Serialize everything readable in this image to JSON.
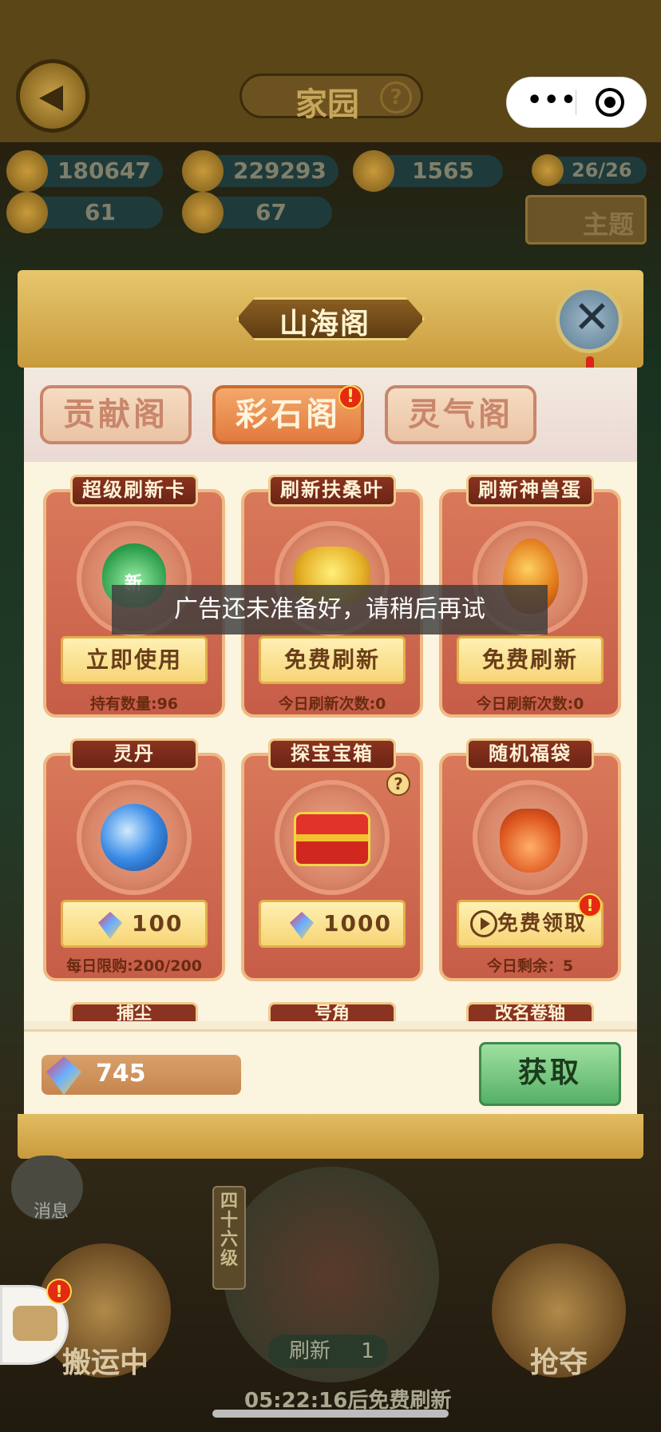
{
  "header": {
    "title": "家园",
    "help_glyph": "?",
    "mini_menu_glyph": "•••"
  },
  "resources": [
    {
      "icon": "gold-ingot-icon",
      "value": "180647"
    },
    {
      "icon": "gold-flower-icon",
      "value": "229293"
    },
    {
      "icon": "gold-lump-icon",
      "value": "1565"
    },
    {
      "icon": "rabbit-icon",
      "value": "26/26"
    },
    {
      "icon": "beast-head-icon",
      "value": "61"
    },
    {
      "icon": "gold-beast-icon",
      "value": "67"
    }
  ],
  "theme_button": "主题",
  "modal": {
    "title": "山海阁",
    "tabs": [
      {
        "label": "贡献阁",
        "active": false
      },
      {
        "label": "彩石阁",
        "active": true,
        "badge": "!"
      },
      {
        "label": "灵气阁",
        "active": false
      }
    ],
    "items": [
      {
        "name": "超级刷新卡",
        "icon": "new-refresh-card-icon",
        "icon_text": "新",
        "button": "立即使用",
        "sub": "持有数量:96"
      },
      {
        "name": "刷新扶桑叶",
        "icon": "gold-leaf-icon",
        "button": "免费刷新",
        "sub": "今日刷新次数:0"
      },
      {
        "name": "刷新神兽蛋",
        "icon": "beast-egg-icon",
        "button": "免费刷新",
        "sub": "今日刷新次数:0"
      },
      {
        "name": "灵丹",
        "icon": "spirit-orb-icon",
        "price": "100",
        "sub": "每日限购:200/200"
      },
      {
        "name": "探宝宝箱",
        "icon": "treasure-chest-icon",
        "price": "1000",
        "help": "?"
      },
      {
        "name": "随机福袋",
        "icon": "lucky-bag-icon",
        "button": "免费领取",
        "badge": "!",
        "sub": "今日剩余：5"
      }
    ],
    "partial_items": [
      "捕尘",
      "号角",
      "改名卷轴"
    ],
    "balance": "745",
    "get_button": "获取"
  },
  "toast": "广告还未准备好，请稍后再试",
  "bottom": {
    "message_label": "消息",
    "left_label": "搬运中",
    "right_label": "抢夺",
    "level_tag": "四十六级",
    "level_help": "?",
    "refresh_label": "刷新",
    "refresh_count": "1",
    "timer": "05:22:16后免费刷新",
    "chat_badge": "!"
  }
}
